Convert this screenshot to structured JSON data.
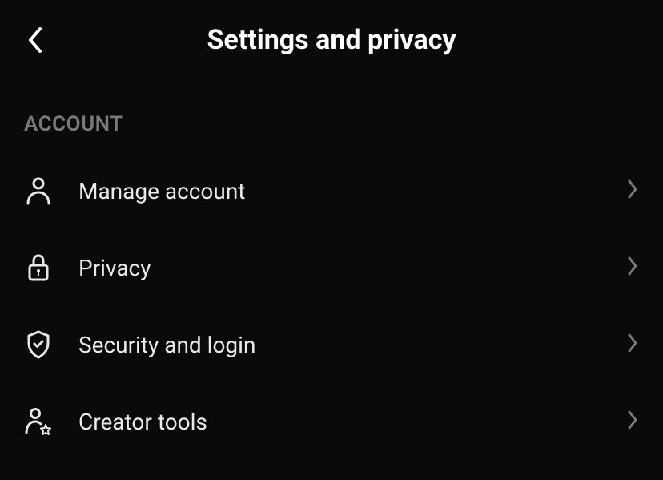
{
  "header": {
    "title": "Settings and privacy"
  },
  "sections": {
    "account": {
      "header": "ACCOUNT",
      "items": [
        {
          "label": "Manage account"
        },
        {
          "label": "Privacy"
        },
        {
          "label": "Security and login"
        },
        {
          "label": "Creator tools"
        }
      ]
    }
  }
}
